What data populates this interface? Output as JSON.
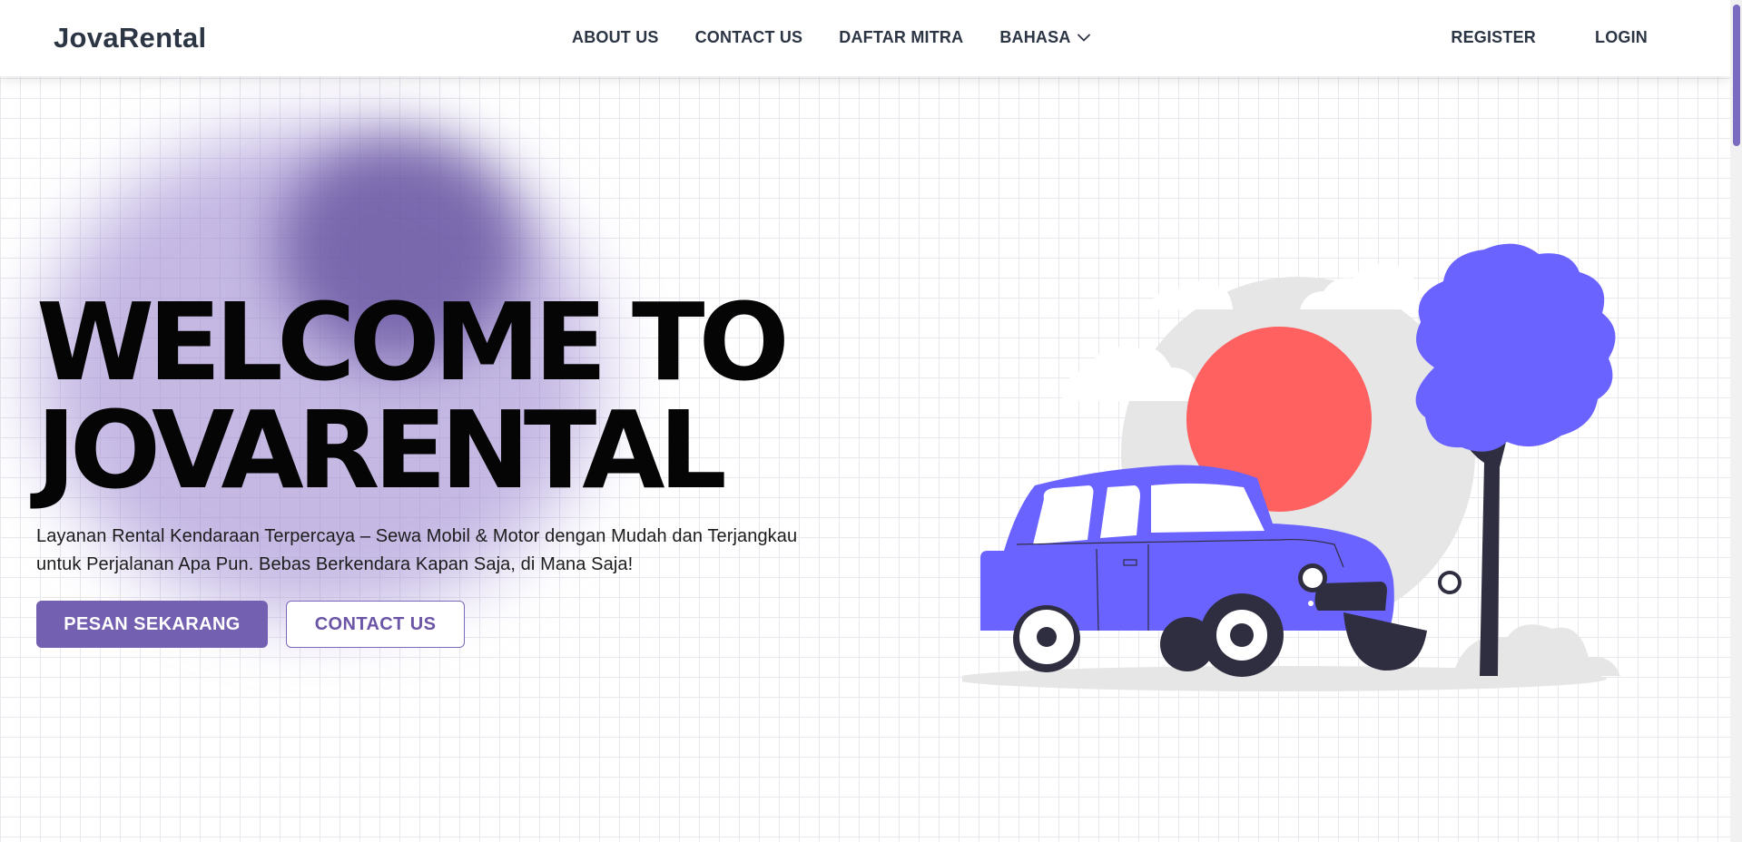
{
  "navbar": {
    "brand": "JovaRental",
    "links": [
      "ABOUT US",
      "CONTACT US",
      "DAFTAR MITRA",
      "BAHASA"
    ],
    "register": "REGISTER",
    "login": "LOGIN"
  },
  "hero": {
    "title_line1": "WELCOME TO",
    "title_line2": "JOVARENTAL",
    "description": "Layanan Rental Kendaraan Terpercaya – Sewa Mobil & Motor dengan Mudah dan Terjangkau untuk Perjalanan Apa Pun. Bebas Berkendara Kapan Saja, di Mana Saja!",
    "primary_button": "PESAN SEKARANG",
    "secondary_button": "CONTACT US"
  },
  "icons": {
    "bahasa_dropdown": "chevron-down-icon",
    "illustration": "car-illustration"
  },
  "colors": {
    "brand_purple": "#7460b0",
    "car_blue": "#6b63ff",
    "sun_red": "#ff6161",
    "dark": "#2f2e41"
  }
}
